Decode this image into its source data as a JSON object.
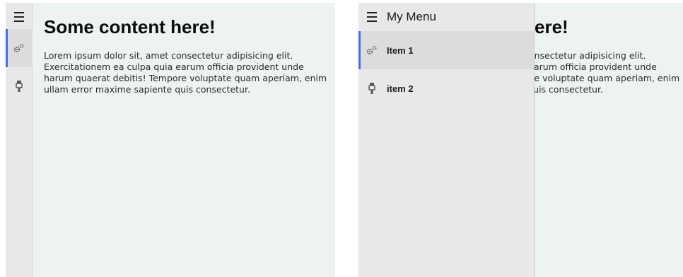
{
  "left_view": {
    "nav": {
      "items": [
        {
          "icon": "gears-icon",
          "active": true
        },
        {
          "icon": "plug-icon",
          "active": false
        }
      ]
    },
    "content": {
      "heading": "Some content here!",
      "body": "Lorem ipsum dolor sit, amet consectetur adipisicing elit. Exercitationem ea culpa quia earum officia provident unde harum quaerat debitis! Tempore voluptate quam aperiam, enim ullam error maxime sapiente quis consectetur."
    }
  },
  "right_view": {
    "menu": {
      "title": "My Menu",
      "items": [
        {
          "label": "Item 1",
          "icon": "gears-icon",
          "active": true
        },
        {
          "label": "item 2",
          "icon": "plug-icon",
          "active": false
        }
      ]
    },
    "content": {
      "heading": "Some content here!",
      "body": "Lorem ipsum dolor sit, amet consectetur adipisicing elit. Exercitationem ea culpa quia earum officia provident unde harum quaerat debitis! Tempore voluptate quam aperiam, enim ullam error maxime sapiente quis consectetur."
    }
  },
  "colors": {
    "accent": "#3f6fe8",
    "content_bg": "#edf3f3",
    "nav_bg": "#e8e8e8",
    "active_bg": "#dcdcdc"
  }
}
